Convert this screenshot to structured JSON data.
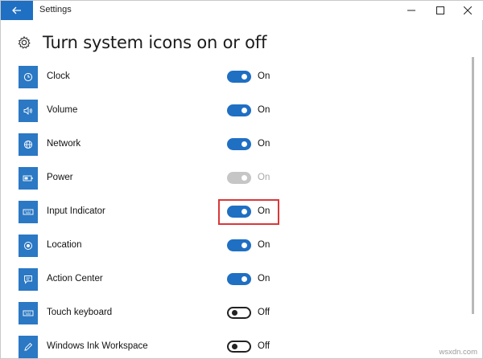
{
  "window": {
    "title": "Settings"
  },
  "header": {
    "title": "Turn system icons on or off"
  },
  "items": [
    {
      "label": "Clock",
      "state": "On",
      "status": "on",
      "icon": "clock-icon"
    },
    {
      "label": "Volume",
      "state": "On",
      "status": "on",
      "icon": "speaker-icon"
    },
    {
      "label": "Network",
      "state": "On",
      "status": "on",
      "icon": "globe-icon"
    },
    {
      "label": "Power",
      "state": "On",
      "status": "disabled",
      "icon": "battery-icon"
    },
    {
      "label": "Input Indicator",
      "state": "On",
      "status": "on",
      "icon": "keyboard-icon"
    },
    {
      "label": "Location",
      "state": "On",
      "status": "on",
      "icon": "location-icon"
    },
    {
      "label": "Action Center",
      "state": "On",
      "status": "on",
      "icon": "action-center-icon"
    },
    {
      "label": "Touch keyboard",
      "state": "Off",
      "status": "off",
      "icon": "keyboard-icon"
    },
    {
      "label": "Windows Ink Workspace",
      "state": "Off",
      "status": "off",
      "icon": "pen-icon"
    }
  ],
  "colors": {
    "accent": "#1f6fc3",
    "tile": "#2b78c4",
    "highlight": "#d9383a"
  },
  "watermark": "wsxdn.com"
}
